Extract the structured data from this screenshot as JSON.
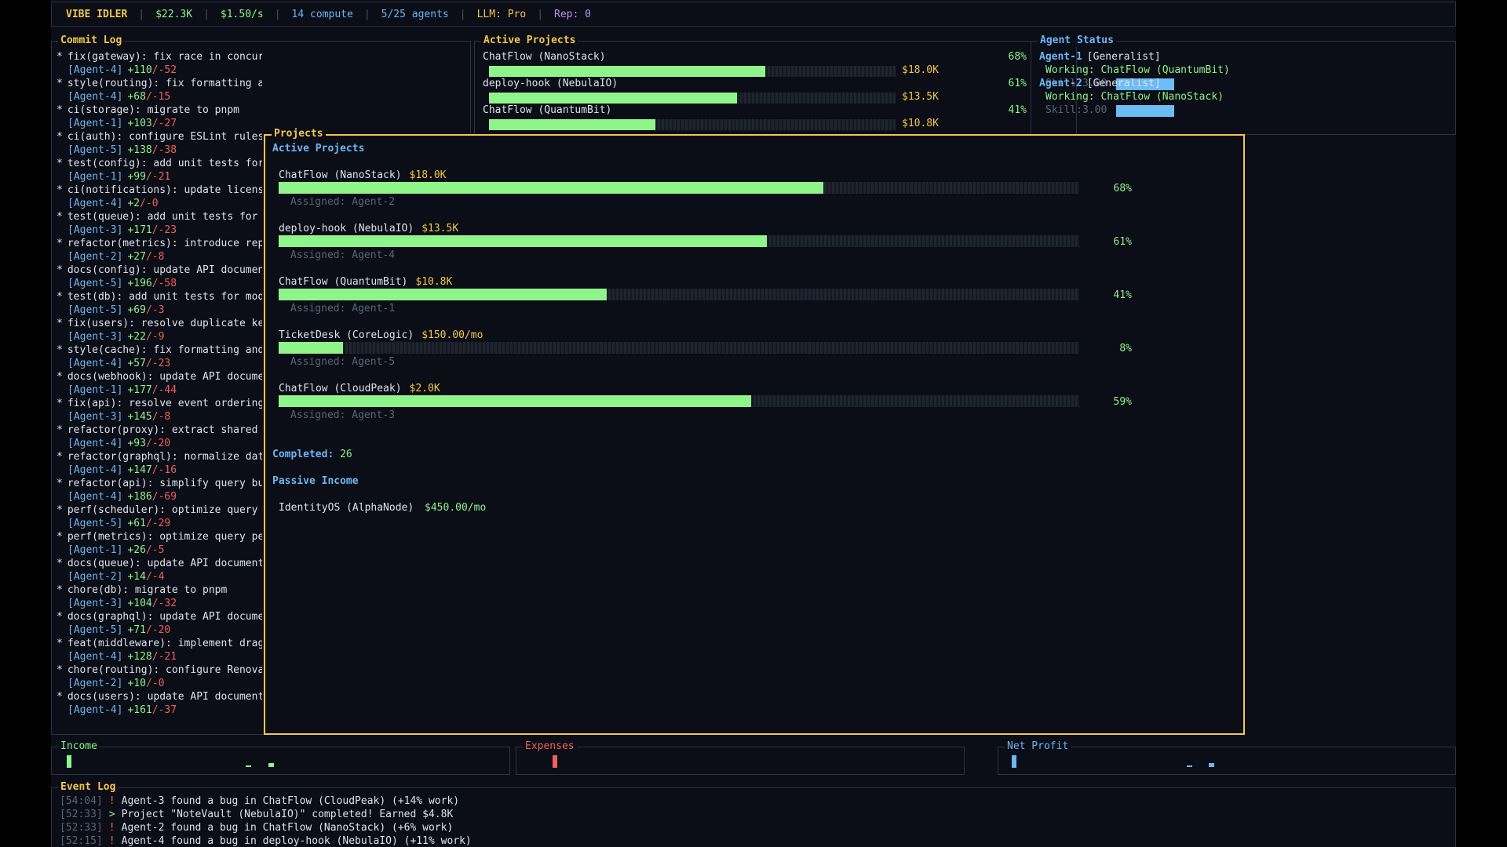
{
  "header": {
    "app_title": "VIBE IDLER",
    "money": "$22.3K",
    "rate": "$1.50/s",
    "compute": "14 compute",
    "agents": "5/25 agents",
    "llm": "LLM: Pro",
    "rep": "Rep: 0"
  },
  "commit_log": {
    "title": "Commit Log",
    "entries": [
      {
        "msg": "fix(gateway): fix race in concurrent writes",
        "agent": "[Agent-4]",
        "add": "+110",
        "del": "/-52"
      },
      {
        "msg": "style(routing): fix formatting and lint issues",
        "agent": "[Agent-4]",
        "add": "+68",
        "del": "/-15"
      },
      {
        "msg": "ci(storage): migrate to pnpm",
        "agent": "[Agent-1]",
        "add": "+103",
        "del": "/-27"
      },
      {
        "msg": "ci(auth): configure ESLint rules",
        "agent": "[Agent-5]",
        "add": "+138",
        "del": "/-38"
      },
      {
        "msg": "test(config): add unit tests for m",
        "agent": "[Agent-1]",
        "add": "+99",
        "del": "/-21"
      },
      {
        "msg": "ci(notifications): update license",
        "agent": "[Agent-4]",
        "add": "+2",
        "del": "/-0"
      },
      {
        "msg": "test(queue): add unit tests for mo",
        "agent": "[Agent-3]",
        "add": "+171",
        "del": "/-23"
      },
      {
        "msg": "refactor(metrics): introduce repos",
        "agent": "[Agent-2]",
        "add": "+27",
        "del": "/-8"
      },
      {
        "msg": "docs(config): update API documenta",
        "agent": "[Agent-5]",
        "add": "+196",
        "del": "/-58"
      },
      {
        "msg": "test(db): add unit tests for modul",
        "agent": "[Agent-5]",
        "add": "+69",
        "del": "/-3"
      },
      {
        "msg": "fix(users): resolve duplicate key",
        "agent": "[Agent-3]",
        "add": "+22",
        "del": "/-9"
      },
      {
        "msg": "style(cache): fix formatting and l",
        "agent": "[Agent-4]",
        "add": "+57",
        "del": "/-23"
      },
      {
        "msg": "docs(webhook): update API document",
        "agent": "[Agent-1]",
        "add": "+177",
        "del": "/-44"
      },
      {
        "msg": "fix(api): resolve event ordering b",
        "agent": "[Agent-3]",
        "add": "+145",
        "del": "/-8"
      },
      {
        "msg": "refactor(proxy): extract shared ut",
        "agent": "[Agent-4]",
        "add": "+93",
        "del": "/-20"
      },
      {
        "msg": "refactor(graphql): normalize datab",
        "agent": "[Agent-4]",
        "add": "+147",
        "del": "/-16"
      },
      {
        "msg": "refactor(api): simplify query buil",
        "agent": "[Agent-4]",
        "add": "+186",
        "del": "/-69"
      },
      {
        "msg": "perf(scheduler): optimize query pe",
        "agent": "[Agent-5]",
        "add": "+61",
        "del": "/-29"
      },
      {
        "msg": "perf(metrics): optimize query perf",
        "agent": "[Agent-1]",
        "add": "+26",
        "del": "/-5"
      },
      {
        "msg": "docs(queue): update API documentat",
        "agent": "[Agent-2]",
        "add": "+14",
        "del": "/-4"
      },
      {
        "msg": "chore(db): migrate to pnpm",
        "agent": "[Agent-3]",
        "add": "+104",
        "del": "/-32"
      },
      {
        "msg": "docs(graphql): update API document",
        "agent": "[Agent-5]",
        "add": "+71",
        "del": "/-20"
      },
      {
        "msg": "feat(middleware): implement drag-a",
        "agent": "[Agent-4]",
        "add": "+128",
        "del": "/-21"
      },
      {
        "msg": "chore(routing): configure Renovate",
        "agent": "[Agent-2]",
        "add": "+10",
        "del": "/-0"
      },
      {
        "msg": "docs(users): update API documentat",
        "agent": "[Agent-4]",
        "add": "+161",
        "del": "/-37"
      }
    ]
  },
  "active_projects_panel": {
    "title": "Active Projects",
    "items": [
      {
        "name": "ChatFlow (NanoStack)",
        "pct": "68%",
        "value": "$18.0K",
        "progress": 0.68
      },
      {
        "name": "deploy-hook (NebulaIO)",
        "pct": "61%",
        "value": "$13.5K",
        "progress": 0.61
      },
      {
        "name": "ChatFlow (QuantumBit)",
        "pct": "41%",
        "value": "$10.8K",
        "progress": 0.41
      }
    ]
  },
  "agent_status": {
    "title": "Agent Status",
    "agents": [
      {
        "name": "Agent-1",
        "role": "[Generalist]",
        "working": "Working: ChatFlow (QuantumBit)",
        "skill": "Skill:3.00"
      },
      {
        "name": "Agent-2",
        "role": "[Generalist]",
        "working": "Working: ChatFlow (NanoStack)",
        "skill": "Skill:3.00"
      }
    ]
  },
  "projects_modal": {
    "title": "Projects",
    "active_heading": "Active Projects",
    "projects": [
      {
        "name": "ChatFlow (NanoStack)",
        "value": "$18.0K",
        "assigned": "Assigned: Agent-2",
        "pct": "68%",
        "progress": 0.68
      },
      {
        "name": "deploy-hook (NebulaIO)",
        "value": "$13.5K",
        "assigned": "Assigned: Agent-4",
        "pct": "61%",
        "progress": 0.61
      },
      {
        "name": "ChatFlow (QuantumBit)",
        "value": "$10.8K",
        "assigned": "Assigned: Agent-1",
        "pct": "41%",
        "progress": 0.41
      },
      {
        "name": "TicketDesk (CoreLogic)",
        "value": "$150.00/mo",
        "assigned": "Assigned: Agent-5",
        "pct": "8%",
        "progress": 0.08
      },
      {
        "name": "ChatFlow (CloudPeak)",
        "value": "$2.0K",
        "assigned": "Assigned: Agent-3",
        "pct": "59%",
        "progress": 0.59
      }
    ],
    "completed_label": "Completed:",
    "completed_value": "26",
    "passive_heading": "Passive Income",
    "passive": [
      {
        "name": "IdentityOS (AlphaNode)",
        "value": "$450.00/mo"
      }
    ]
  },
  "charts": {
    "income_title": "Income",
    "expenses_title": "Expenses",
    "net_title": "Net Profit"
  },
  "event_log": {
    "title": "Event Log",
    "events": [
      {
        "time": "[54:04]",
        "sym": "!",
        "text": "Agent-3 found a bug in ChatFlow (CloudPeak) (+14% work)"
      },
      {
        "time": "[52:33]",
        "sym": ">",
        "text": "Project \"NoteVault (NebulaIO)\" completed! Earned $4.8K"
      },
      {
        "time": "[52:33]",
        "sym": "!",
        "text": "Agent-2 found a bug in ChatFlow (NanoStack) (+6% work)"
      },
      {
        "time": "[52:15]",
        "sym": "!",
        "text": "Agent-4 found a bug in deploy-hook (NebulaIO) (+11% work)"
      }
    ]
  },
  "colors": {
    "accent_yellow": "#f2c84b",
    "green": "#8ff58a",
    "red": "#f0605a",
    "blue": "#6cb6f5",
    "purple": "#c08cf5"
  }
}
